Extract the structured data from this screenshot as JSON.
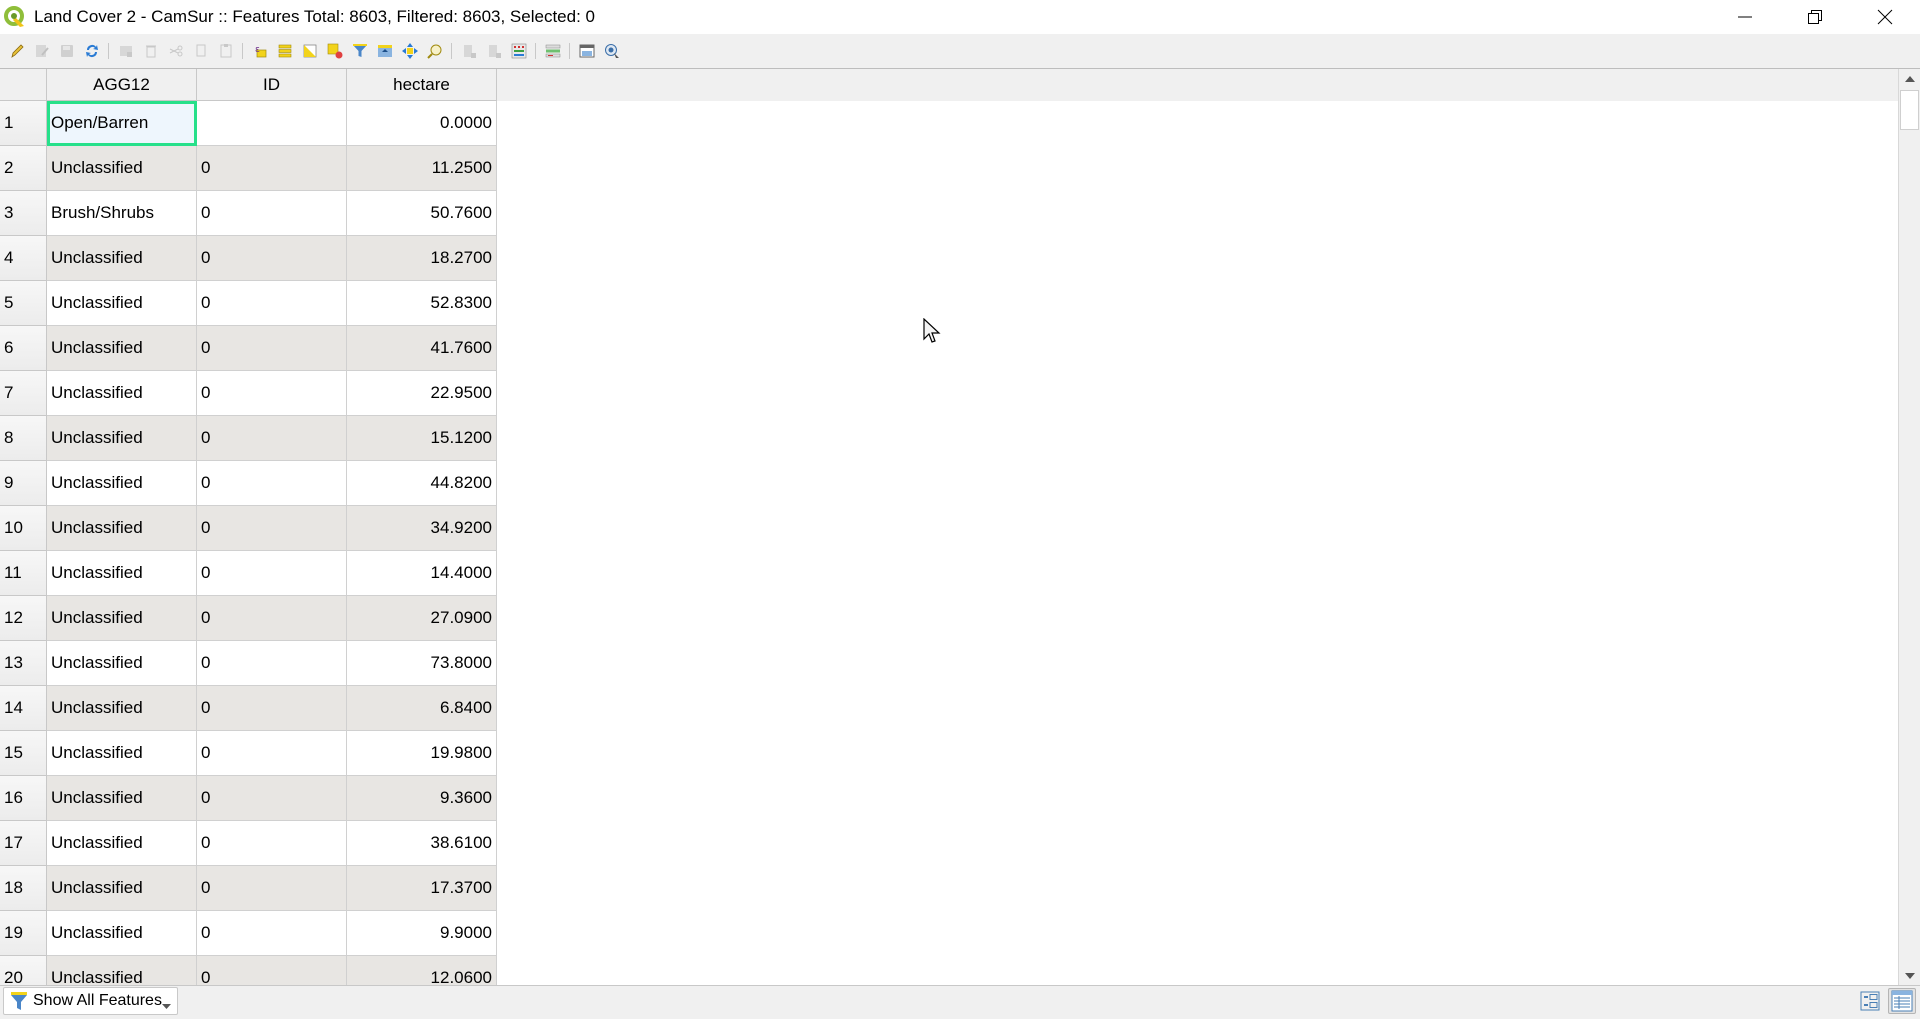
{
  "window": {
    "title": "Land Cover 2 - CamSur :: Features Total: 8603, Filtered: 8603, Selected: 0",
    "app_icon": "qgis-logo-icon",
    "controls": [
      "minimize-icon",
      "restore-icon",
      "close-icon"
    ]
  },
  "toolbar": {
    "buttons": [
      {
        "icon": "pencil-toggle-editing-icon",
        "enabled": true
      },
      {
        "icon": "multi-edit-icon",
        "enabled": false
      },
      {
        "icon": "save-edits-icon",
        "enabled": false
      },
      {
        "icon": "reload-icon",
        "enabled": true
      },
      {
        "icon": "add-feature-icon",
        "enabled": false
      },
      {
        "icon": "delete-selected-icon",
        "enabled": false
      },
      {
        "icon": "cut-icon",
        "enabled": false
      },
      {
        "icon": "copy-icon",
        "enabled": false
      },
      {
        "icon": "paste-icon",
        "enabled": false
      },
      {
        "icon": "select-by-expression-icon",
        "enabled": true
      },
      {
        "icon": "select-all-icon",
        "enabled": true
      },
      {
        "icon": "invert-selection-icon",
        "enabled": true
      },
      {
        "icon": "deselect-all-icon",
        "enabled": true
      },
      {
        "icon": "filter-icon",
        "enabled": true
      },
      {
        "icon": "move-selection-to-top-icon",
        "enabled": true
      },
      {
        "icon": "pan-to-selected-icon",
        "enabled": true
      },
      {
        "icon": "zoom-to-selected-icon",
        "enabled": true
      },
      {
        "icon": "new-field-icon",
        "enabled": false
      },
      {
        "icon": "delete-field-icon",
        "enabled": false
      },
      {
        "icon": "field-calculator-icon",
        "enabled": true
      },
      {
        "icon": "conditional-formatting-icon",
        "enabled": true
      },
      {
        "icon": "dock-table-icon",
        "enabled": true
      },
      {
        "icon": "actions-icon",
        "enabled": true
      }
    ]
  },
  "table": {
    "columns": [
      "AGG12",
      "ID",
      "hectare"
    ],
    "rows": [
      {
        "n": "1",
        "AGG12": "Open/Barren",
        "ID": "",
        "hectare": "0.0000"
      },
      {
        "n": "2",
        "AGG12": "Unclassified",
        "ID": "0",
        "hectare": "11.2500"
      },
      {
        "n": "3",
        "AGG12": "Brush/Shrubs",
        "ID": "0",
        "hectare": "50.7600"
      },
      {
        "n": "4",
        "AGG12": "Unclassified",
        "ID": "0",
        "hectare": "18.2700"
      },
      {
        "n": "5",
        "AGG12": "Unclassified",
        "ID": "0",
        "hectare": "52.8300"
      },
      {
        "n": "6",
        "AGG12": "Unclassified",
        "ID": "0",
        "hectare": "41.7600"
      },
      {
        "n": "7",
        "AGG12": "Unclassified",
        "ID": "0",
        "hectare": "22.9500"
      },
      {
        "n": "8",
        "AGG12": "Unclassified",
        "ID": "0",
        "hectare": "15.1200"
      },
      {
        "n": "9",
        "AGG12": "Unclassified",
        "ID": "0",
        "hectare": "44.8200"
      },
      {
        "n": "10",
        "AGG12": "Unclassified",
        "ID": "0",
        "hectare": "34.9200"
      },
      {
        "n": "11",
        "AGG12": "Unclassified",
        "ID": "0",
        "hectare": "14.4000"
      },
      {
        "n": "12",
        "AGG12": "Unclassified",
        "ID": "0",
        "hectare": "27.0900"
      },
      {
        "n": "13",
        "AGG12": "Unclassified",
        "ID": "0",
        "hectare": "73.8000"
      },
      {
        "n": "14",
        "AGG12": "Unclassified",
        "ID": "0",
        "hectare": "6.8400"
      },
      {
        "n": "15",
        "AGG12": "Unclassified",
        "ID": "0",
        "hectare": "19.9800"
      },
      {
        "n": "16",
        "AGG12": "Unclassified",
        "ID": "0",
        "hectare": "9.3600"
      },
      {
        "n": "17",
        "AGG12": "Unclassified",
        "ID": "0",
        "hectare": "38.6100"
      },
      {
        "n": "18",
        "AGG12": "Unclassified",
        "ID": "0",
        "hectare": "17.3700"
      },
      {
        "n": "19",
        "AGG12": "Unclassified",
        "ID": "0",
        "hectare": "9.9000"
      },
      {
        "n": "20",
        "AGG12": "Unclassified",
        "ID": "0",
        "hectare": "12.0600"
      }
    ],
    "current_cell": {
      "row": 0,
      "column": "AGG12"
    },
    "colors": {
      "alt_row": "#e8e6e3",
      "current_cell_border": "#26e08a"
    }
  },
  "bottom": {
    "filter_button_label": "Show All Features",
    "view_modes": [
      {
        "name": "form-view",
        "active": false
      },
      {
        "name": "table-view",
        "active": true
      }
    ]
  }
}
